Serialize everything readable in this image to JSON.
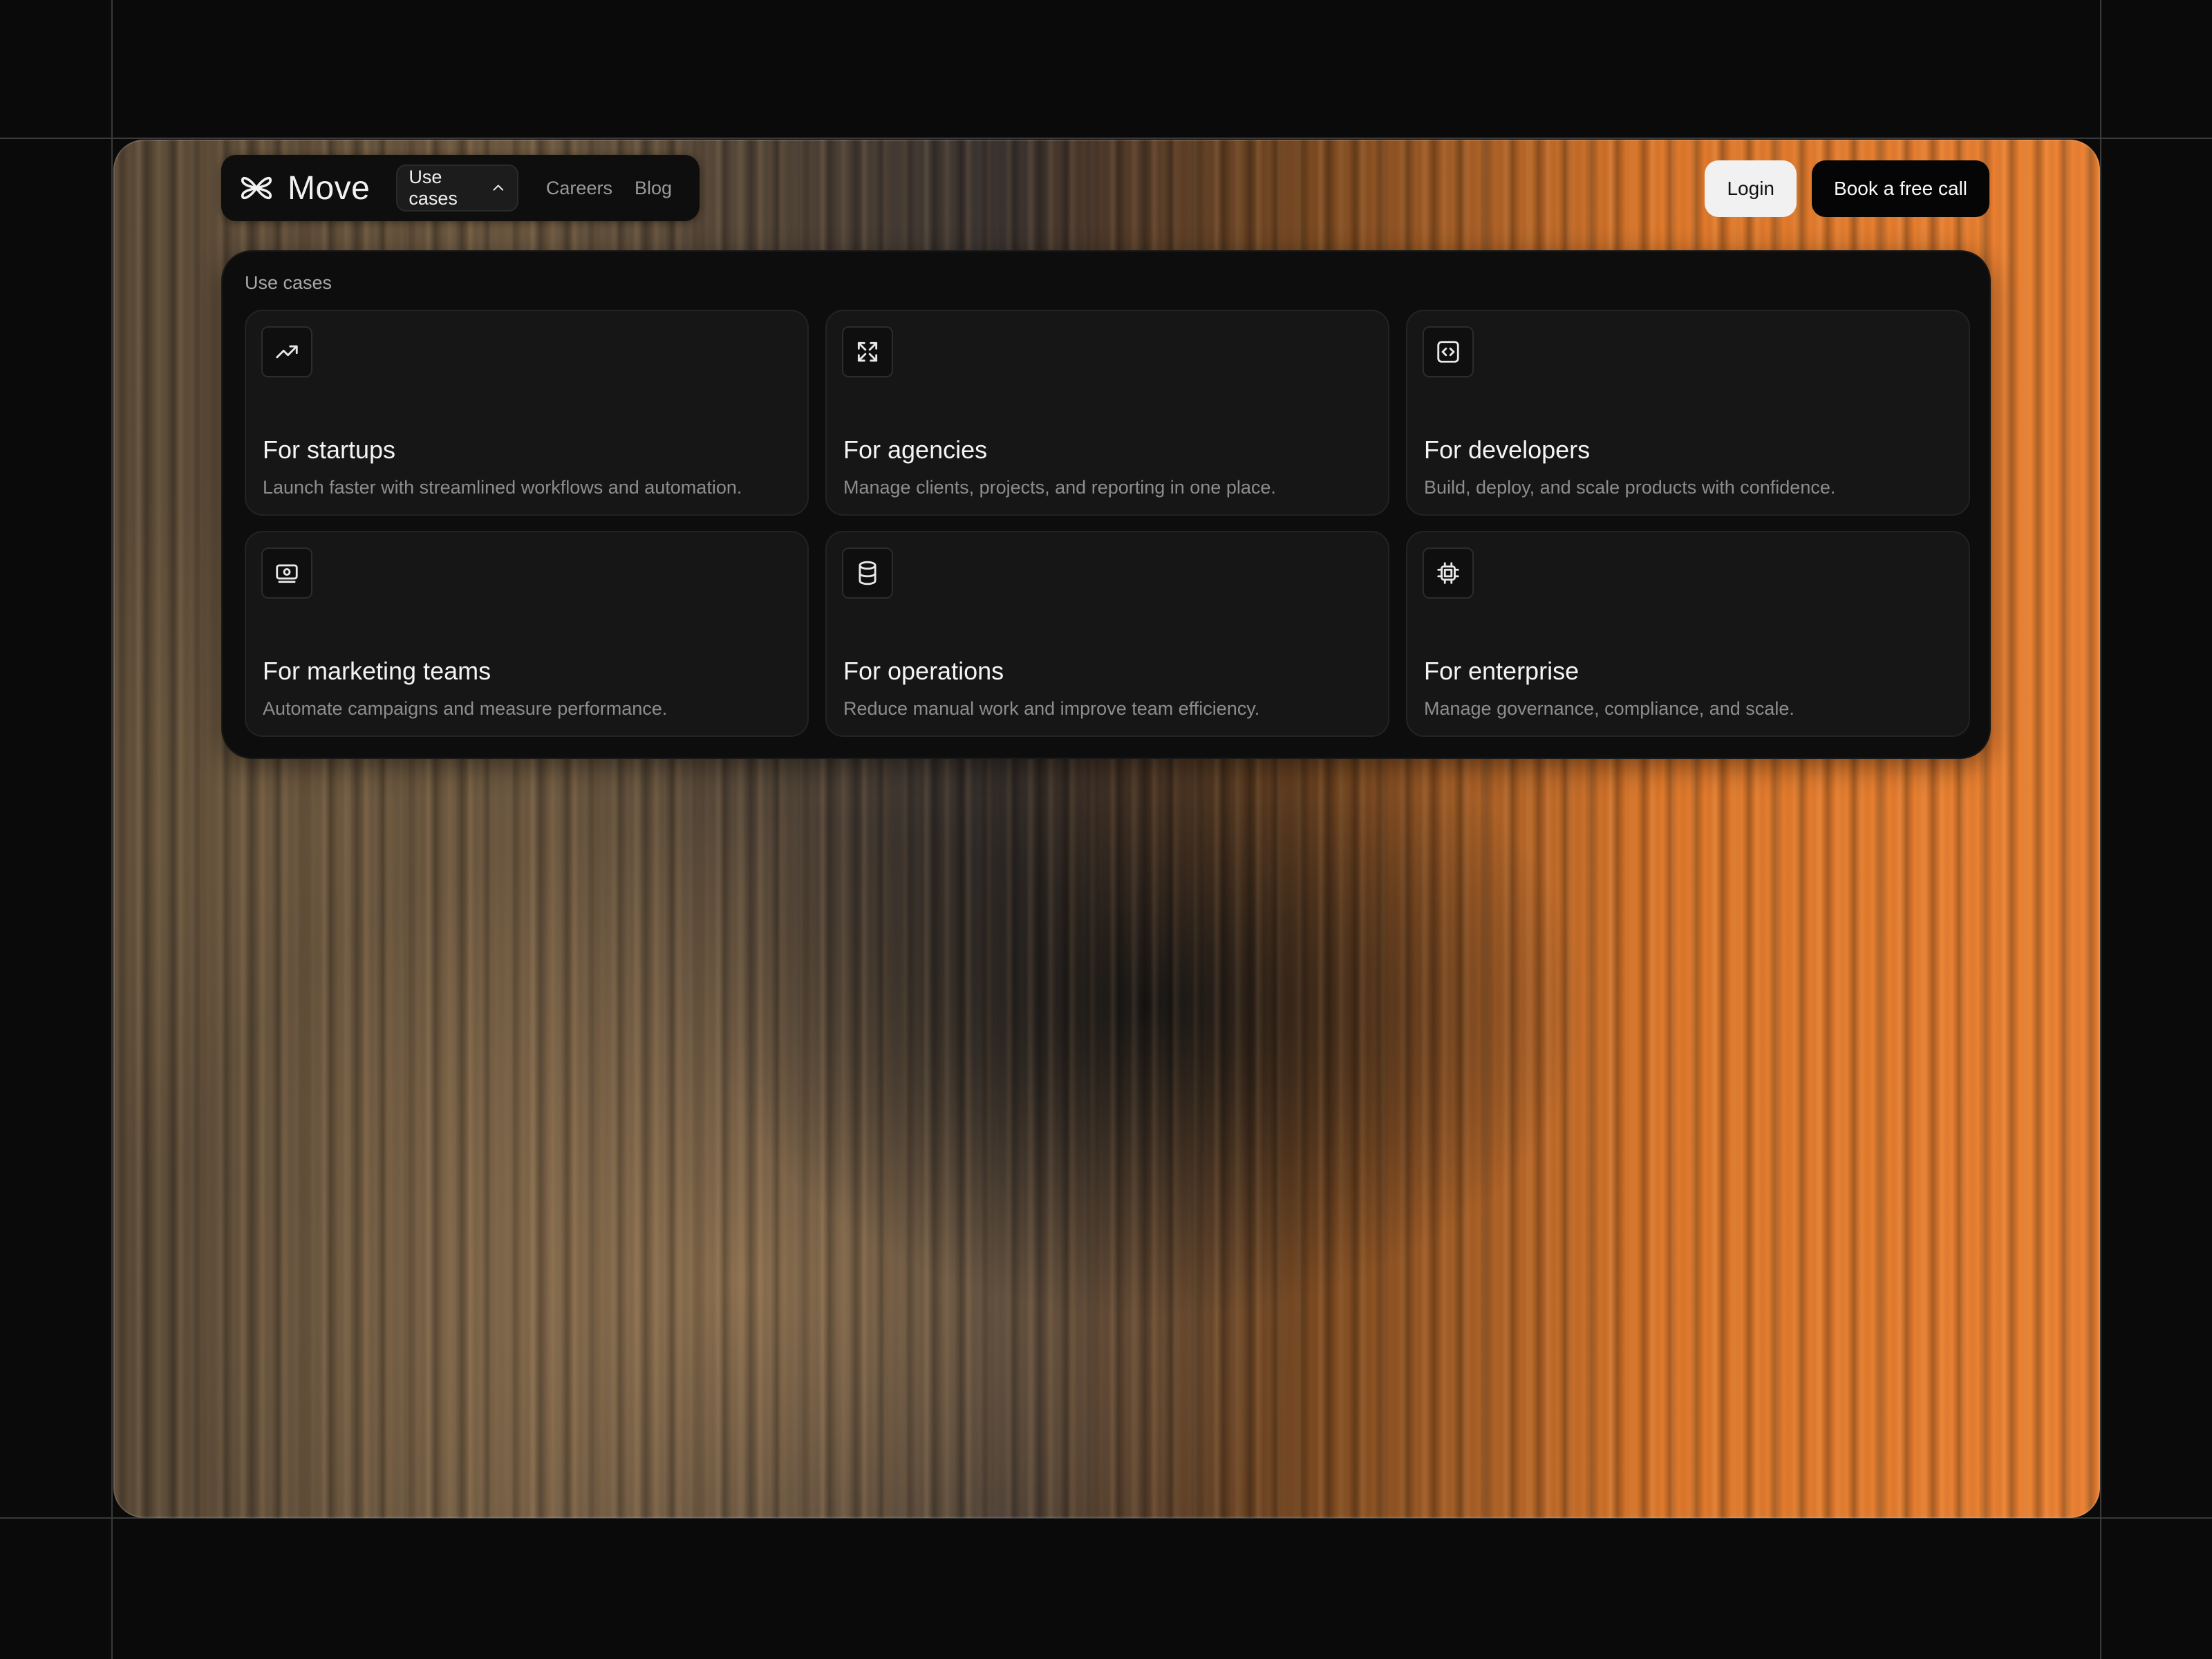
{
  "brand": {
    "name": "Move",
    "icon": "flower-logo-icon"
  },
  "nav": {
    "active": {
      "label": "Use cases",
      "icon": "chevron-up-icon"
    },
    "links": [
      "Careers",
      "Blog"
    ],
    "login_label": "Login",
    "cta_label": "Book a free call"
  },
  "panel": {
    "title": "Use cases",
    "cards": [
      {
        "icon": "trending-up-icon",
        "title": "For startups",
        "desc": "Launch faster with streamlined workflows and automation."
      },
      {
        "icon": "expand-icon",
        "title": "For agencies",
        "desc": "Manage clients, projects, and reporting in one place."
      },
      {
        "icon": "code-icon",
        "title": "For developers",
        "desc": "Build, deploy, and scale products with confidence."
      },
      {
        "icon": "banknote-icon",
        "title": "For marketing teams",
        "desc": "Automate campaigns and measure performance."
      },
      {
        "icon": "database-icon",
        "title": "For operations",
        "desc": "Reduce manual work and improve team efficiency."
      },
      {
        "icon": "chip-icon",
        "title": "For enterprise",
        "desc": "Manage governance, compliance, and scale."
      }
    ]
  },
  "colors": {
    "accent": "#ee8434",
    "background": "#0a0a0a",
    "panel": "#0d0d0d",
    "card": "#161616"
  }
}
